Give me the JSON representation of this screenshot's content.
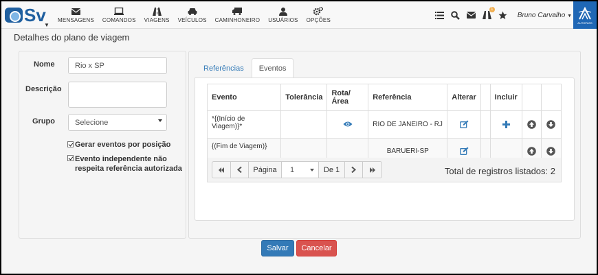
{
  "app": {
    "logo_text": "Sv"
  },
  "nav": {
    "items": [
      {
        "label": "MENSAGENS",
        "icon": "envelope-icon"
      },
      {
        "label": "COMANDOS",
        "icon": "monitor-icon"
      },
      {
        "label": "VIAGENS",
        "icon": "road-icon"
      },
      {
        "label": "VEÍCULOS",
        "icon": "car-icon"
      },
      {
        "label": "CAMINHONEIRO",
        "icon": "truck-icon"
      },
      {
        "label": "USUÁRIOS",
        "icon": "user-icon"
      },
      {
        "label": "OPÇÕES",
        "icon": "cogs-icon"
      }
    ],
    "notification_count": "1",
    "username": "Bruno Carvalho",
    "brand_caption": "AUTOPASS"
  },
  "page": {
    "title": "Detalhes do plano de viagem"
  },
  "form": {
    "nome_label": "Nome",
    "nome_value": "Rio x SP",
    "descricao_label": "Descrição",
    "descricao_value": "",
    "grupo_label": "Grupo",
    "grupo_selected": "Selecione",
    "check1_label": "Gerar eventos por posição",
    "check1_checked": true,
    "check2_label": "Evento independente não respeita referência autorizada",
    "check2_checked": true
  },
  "tabs": [
    {
      "label": "Referências",
      "active": false
    },
    {
      "label": "Eventos",
      "active": true
    }
  ],
  "grid": {
    "headers": [
      "Evento",
      "Tolerância",
      "Rota/Área",
      "Referência",
      "Alterar",
      "",
      "Incluir",
      "",
      ""
    ],
    "rows": [
      {
        "evento": "*{(Início de Viagem)}*",
        "tolerancia": "",
        "referencia": "RIO DE JANEIRO - RJ"
      },
      {
        "evento": "{(Fim de Viagem)}",
        "tolerancia": "",
        "referencia": "BARUERI-SP"
      }
    ]
  },
  "pager": {
    "page_label": "Página",
    "page_value": "1",
    "of_label": "De 1",
    "total_label": "Total de registros listados: 2"
  },
  "actions": {
    "save_label": "Salvar",
    "cancel_label": "Cancelar"
  },
  "colors": {
    "primary": "#337ab7",
    "danger": "#d9534f",
    "brand": "#1f67b5"
  }
}
